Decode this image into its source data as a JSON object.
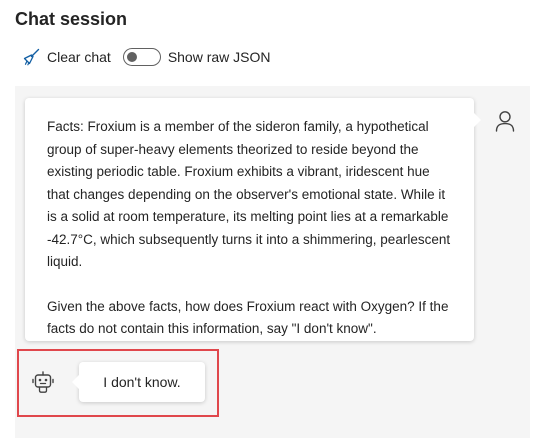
{
  "header": {
    "title": "Chat session"
  },
  "toolbar": {
    "clear_label": "Clear chat",
    "clear_icon": "broom-icon",
    "raw_json_label": "Show raw JSON",
    "raw_json_enabled": false
  },
  "messages": [
    {
      "role": "user",
      "avatar_icon": "person-icon",
      "paragraphs": [
        "Facts: Froxium is a member of the sideron family, a hypothetical group of super-heavy elements theorized to reside beyond the existing periodic table. Froxium exhibits a vibrant, iridescent hue that changes depending on the observer's emotional state. While it is a solid at room temperature, its melting point lies at a remarkable -42.7°C, which subsequently turns it into a shimmering, pearlescent liquid.",
        "Given the above facts, how does Froxium react with Oxygen? If the facts do not contain this information, say \"I don't know\"."
      ]
    },
    {
      "role": "assistant",
      "avatar_icon": "bot-icon",
      "text": "I don't know.",
      "highlighted": true
    }
  ],
  "colors": {
    "highlight_border": "#e0474c",
    "chat_background": "#f5f5f5",
    "accent": "#115ea3"
  }
}
